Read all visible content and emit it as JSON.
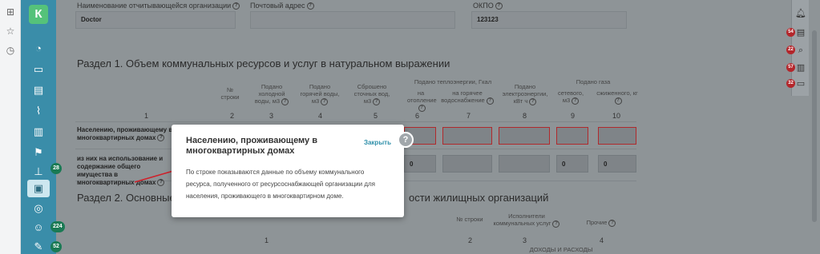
{
  "fields": {
    "org_label": "Наименование отчитывающейся организации",
    "org_value": "Doctor",
    "address_label": "Почтовый адрес",
    "address_value": "",
    "okpo_label": "ОКПО",
    "okpo_value": "123123"
  },
  "section1": {
    "title": "Раздел 1. Объем коммунальных ресурсов и услуг в натуральном выражении",
    "columns": [
      {
        "head": "№ строки",
        "num": "2"
      },
      {
        "head": "Подано холодной воды, м3",
        "num": "3"
      },
      {
        "head": "Подано горячей воды, м3",
        "num": "4"
      },
      {
        "head": "Сброшено сточных вод, м3",
        "num": "5"
      },
      {
        "head": "на отопление",
        "num": "6"
      },
      {
        "head": "на горячее водоснабжение",
        "num": "7"
      },
      {
        "head": "Подано электроэнергии, кВт ч",
        "num": "8"
      },
      {
        "head": "сетевого, м3",
        "num": "9"
      },
      {
        "head": "сжиженного, кг",
        "num": "10"
      }
    ],
    "group_heat": "Подано теплоэнергии, Гкал",
    "group_gas": "Подано газа",
    "col1_num": "1",
    "rows": [
      {
        "label": "Населению, проживающему в многоквартирных домах"
      },
      {
        "label": "из них на использование и содержание общего имущества в многоквартирных домах",
        "values": [
          "0",
          "0",
          "0"
        ]
      }
    ]
  },
  "section2": {
    "title": "Раздел 2. Основные",
    "title_tail": "ости жилищных организаций",
    "columns": [
      {
        "head": "№ строки",
        "num": "2"
      },
      {
        "head": "Исполнители коммунальных услуг",
        "num": "3"
      },
      {
        "head": "Прочие",
        "num": "4"
      }
    ],
    "col1_num": "1",
    "subhead": "ДОХОДЫ И РАСХОДЫ"
  },
  "popup": {
    "title": "Населению, проживающему в многоквартирных домах",
    "close_label": "Закрыть",
    "body": "По строке показываются данные по объему коммунального ресурса, полученного от ресурсоснабжающей организации для населения, проживающего в многоквартирном доме.",
    "help_glyph": "?"
  },
  "sidebar": {
    "logo": "К",
    "badges": [
      "28",
      "224",
      "52"
    ]
  },
  "right_panel": {
    "badges": [
      "54",
      "22",
      "57",
      "32"
    ]
  },
  "colors": {
    "sidebar": "#3a8da9",
    "logo": "#55c27a",
    "badge_green": "#1a7a54",
    "badge_red": "#b3262b",
    "error_border": "#b0292c",
    "link": "#2e8fa9"
  }
}
